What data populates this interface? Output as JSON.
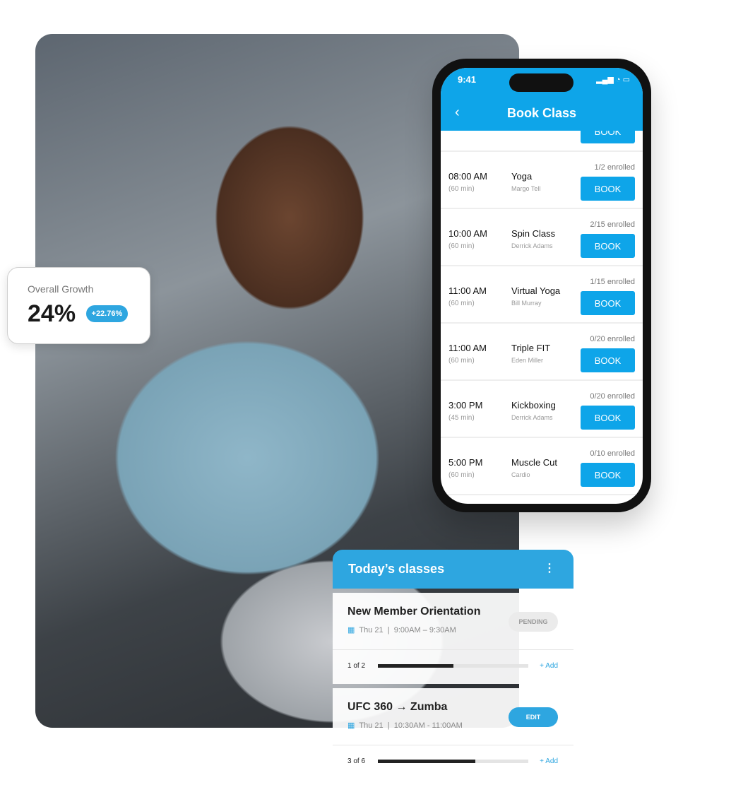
{
  "growth": {
    "label": "Overall Growth",
    "value": "24%",
    "change": "+22.76%"
  },
  "phone": {
    "time": "9:41",
    "status_icons": "signal wifi battery",
    "title": "Book Class",
    "back_icon": "chevron-left",
    "classes": [
      {
        "time": "08:00 AM",
        "duration": "(60 min)",
        "name": "Yoga",
        "instructor": "Margo Tell",
        "enrolled": "1/2 enrolled",
        "button": "BOOK"
      },
      {
        "time": "10:00 AM",
        "duration": "(60 min)",
        "name": "Spin Class",
        "instructor": "Derrick Adams",
        "enrolled": "2/15 enrolled",
        "button": "BOOK"
      },
      {
        "time": "11:00 AM",
        "duration": "(60 min)",
        "name": "Virtual Yoga",
        "instructor": "Bill Murray",
        "enrolled": "1/15 enrolled",
        "button": "BOOK"
      },
      {
        "time": "11:00 AM",
        "duration": "(60 min)",
        "name": "Triple FIT",
        "instructor": "Eden Miller",
        "enrolled": "0/20 enrolled",
        "button": "BOOK"
      },
      {
        "time": "3:00 PM",
        "duration": "(45 min)",
        "name": "Kickboxing",
        "instructor": "Derrick Adams",
        "enrolled": "0/20 enrolled",
        "button": "BOOK"
      },
      {
        "time": "5:00 PM",
        "duration": "(60 min)",
        "name": "Muscle Cut",
        "instructor": "Cardio",
        "enrolled": "0/10 enrolled",
        "button": "BOOK"
      }
    ]
  },
  "today": {
    "title": "Today’s classes",
    "menu_icon": "more-vertical",
    "items": [
      {
        "name": "New Member Orientation",
        "day": "Thu 21",
        "time": "9:00AM – 9:30AM",
        "status": "PENDING",
        "count": "1 of 2",
        "progress": 0.5,
        "add": "+ Add"
      },
      {
        "name": "UFC 360 → Zumba",
        "day": "Thu 21",
        "time": "10:30AM - 11:00AM",
        "status": "EDIT",
        "count": "3 of 6",
        "progress": 0.65,
        "add": "+ Add"
      }
    ]
  },
  "colors": {
    "accent": "#0ea5e9",
    "card_header": "#2ea6e0"
  }
}
